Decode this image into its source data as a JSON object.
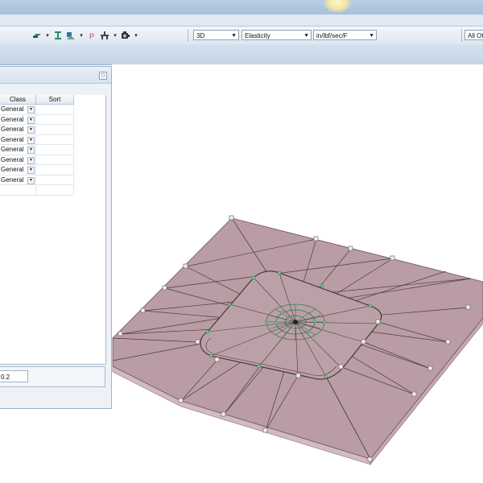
{
  "toolbar": {
    "icons": [
      "plate-icon",
      "beam-icon",
      "support-icon",
      "point-load-icon",
      "member-icon",
      "camera-icon"
    ],
    "view_select": "3D",
    "property_select": "Elasticity",
    "units_select": "in/lbf/sec/F",
    "filter_select": "All Ot"
  },
  "panel": {
    "columns": [
      "Class",
      "Sort"
    ],
    "rows": [
      {
        "class": "General",
        "sort": ""
      },
      {
        "class": "General",
        "sort": ""
      },
      {
        "class": "General",
        "sort": ""
      },
      {
        "class": "General",
        "sort": ""
      },
      {
        "class": "General",
        "sort": ""
      },
      {
        "class": "General",
        "sort": ""
      },
      {
        "class": "General",
        "sort": ""
      },
      {
        "class": "General",
        "sort": ""
      }
    ],
    "value_field": "0.2"
  },
  "colors": {
    "plate_top": "#ba9ca5",
    "plate_edge": "#d2b8bf",
    "node": "#4fb86a",
    "selection_node": "#7a7a7a"
  }
}
